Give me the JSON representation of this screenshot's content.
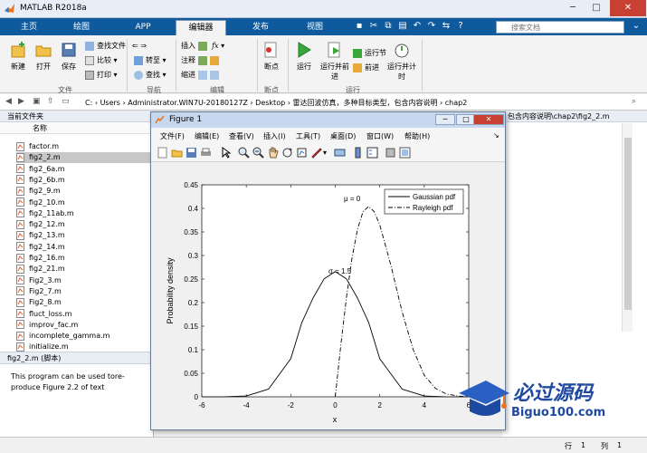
{
  "app": {
    "title": "MATLAB R2018a"
  },
  "ribbon_tabs": [
    "主页",
    "绘图",
    "APP",
    "编辑器",
    "发布",
    "视图"
  ],
  "search": {
    "placeholder": "搜索文档"
  },
  "ribbon": {
    "file_group": {
      "new": "新建",
      "open": "打开",
      "save": "保存",
      "find_file": "查找文件",
      "compare": "比较",
      "print": "打印",
      "label": "文件"
    },
    "nav_group": {
      "goto": "转至",
      "find": "查找",
      "label": "导航"
    },
    "edit_group": {
      "insert": "插入",
      "comment": "注释",
      "indent": "缩进",
      "label": "编辑"
    },
    "breakpoint_group": {
      "breakpoints": "断点",
      "label": "断点"
    },
    "run_group": {
      "run": "运行",
      "run_advance": "运行并前进",
      "run_section": "运行节",
      "advance": "前进",
      "run_time": "运行并计时",
      "label": "运行"
    }
  },
  "address": {
    "path": "C: › Users › Administrator.WIN7U-20180127Z › Desktop › 雷达回波仿真，多种目标类型，包含内容说明 › chap2"
  },
  "current_folder": {
    "title": "当前文件夹",
    "header_name": "名称",
    "files": [
      "factor.m",
      "fig2_2.m",
      "fig2_6a.m",
      "fig2_6b.m",
      "fig2_9.m",
      "fig2_10.m",
      "fig2_11ab.m",
      "fig2_12.m",
      "fig2_13.m",
      "fig2_14.m",
      "fig2_16.m",
      "fig2_21.m",
      "Fig2_3.m",
      "Fig2_7.m",
      "Fig2_8.m",
      "fluct_loss.m",
      "improv_fac.m",
      "incomplete_gamma.m",
      "initialize.m"
    ],
    "selected_index": 1,
    "status_file": "fig2_2.m  (脚本)",
    "description": "This program can be used tore-produce Figure 2.2 of text"
  },
  "editor_tab": "包含内容说明\\chap2\\fig2_2.m",
  "statusbar": {
    "row_label": "行",
    "row_value": "1",
    "col_label": "列",
    "col_value": "1"
  },
  "figure": {
    "title": "Figure 1",
    "menus": [
      "文件(F)",
      "编辑(E)",
      "查看(V)",
      "插入(I)",
      "工具(T)",
      "桌面(D)",
      "窗口(W)",
      "帮助(H)"
    ]
  },
  "chart_data": {
    "type": "line",
    "title": "",
    "xlabel": "x",
    "ylabel": "Probability density",
    "xlim": [
      -6,
      6
    ],
    "ylim": [
      0,
      0.45
    ],
    "xticks": [
      -6,
      -4,
      -2,
      0,
      2,
      4,
      6
    ],
    "yticks": [
      0,
      0.05,
      0.1,
      0.15,
      0.2,
      0.25,
      0.3,
      0.35,
      0.4,
      0.45
    ],
    "legend_position": "top-right",
    "series": [
      {
        "name": "Gaussian pdf",
        "style": "solid",
        "color": "#000000",
        "x": [
          -6,
          -5,
          -4,
          -3,
          -2,
          -1.5,
          -1,
          -0.5,
          0,
          0.5,
          1,
          1.5,
          2,
          3,
          4,
          5,
          6
        ],
        "y": [
          0.0,
          0.0001,
          0.0018,
          0.0165,
          0.0807,
          0.1579,
          0.2096,
          0.2506,
          0.266,
          0.2506,
          0.2096,
          0.1579,
          0.0807,
          0.0165,
          0.0018,
          0.0001,
          0.0
        ]
      },
      {
        "name": "Rayleigh pdf",
        "style": "dashdot",
        "color": "#000000",
        "x": [
          0,
          0.25,
          0.5,
          0.75,
          1,
          1.25,
          1.5,
          1.75,
          2,
          2.5,
          3,
          3.5,
          4,
          4.5,
          5,
          5.5,
          6
        ],
        "y": [
          0,
          0.109,
          0.21,
          0.293,
          0.356,
          0.393,
          0.404,
          0.393,
          0.365,
          0.279,
          0.181,
          0.101,
          0.046,
          0.018,
          0.006,
          0.002,
          0.0
        ]
      }
    ],
    "annotations": [
      {
        "text": "σ = 1.5"
      },
      {
        "text": "μ = 0"
      }
    ]
  }
}
